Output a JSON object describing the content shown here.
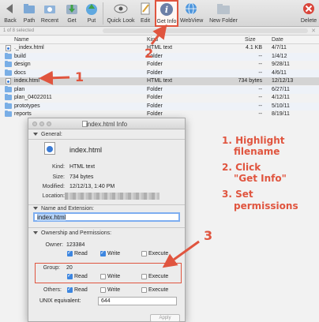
{
  "toolbar": {
    "buttons": [
      {
        "label": "Back"
      },
      {
        "label": "Path"
      },
      {
        "label": "Recent"
      },
      {
        "label": "Get"
      },
      {
        "label": "Put"
      },
      {
        "label": "Quick Look"
      },
      {
        "label": "Edit"
      },
      {
        "label": "Get Info"
      },
      {
        "label": "WebView"
      },
      {
        "label": "New Folder"
      },
      {
        "label": "Delete"
      }
    ]
  },
  "status": {
    "text": "1 of 8 selected"
  },
  "file_list": {
    "columns": {
      "name": "Name",
      "kind": "Kind",
      "size": "Size",
      "date": "Date"
    },
    "rows": [
      {
        "name": "._index.html",
        "kind": "HTML text",
        "size": "4.1 KB",
        "date": "4/7/11",
        "type": "doc"
      },
      {
        "name": "build",
        "kind": "Folder",
        "size": "--",
        "date": "1/4/12",
        "type": "folder"
      },
      {
        "name": "design",
        "kind": "Folder",
        "size": "--",
        "date": "9/28/11",
        "type": "folder"
      },
      {
        "name": "docs",
        "kind": "Folder",
        "size": "--",
        "date": "4/6/11",
        "type": "folder"
      },
      {
        "name": "index.html",
        "kind": "HTML text",
        "size": "734 bytes",
        "date": "12/12/13",
        "type": "doc"
      },
      {
        "name": "plan",
        "kind": "Folder",
        "size": "--",
        "date": "6/27/11",
        "type": "folder"
      },
      {
        "name": "plan_04022011",
        "kind": "Folder",
        "size": "--",
        "date": "4/12/11",
        "type": "folder"
      },
      {
        "name": "prototypes",
        "kind": "Folder",
        "size": "--",
        "date": "5/10/11",
        "type": "folder"
      },
      {
        "name": "reports",
        "kind": "Folder",
        "size": "--",
        "date": "8/19/11",
        "type": "folder"
      }
    ]
  },
  "info_window": {
    "title": "index.html Info",
    "general_label": "General:",
    "filename": "index.html",
    "kind_label": "Kind:",
    "kind": "HTML text",
    "size_label": "Size:",
    "size": "734 bytes",
    "modified_label": "Modified:",
    "modified": "12/12/13, 1:40 PM",
    "location_label": "Location:",
    "name_ext_label": "Name and Extension:",
    "name_value": "index.html",
    "ownership_label": "Ownership and Permissions:",
    "owner_label": "Owner:",
    "owner_value": "123384",
    "group_label": "Group:",
    "group_value": "20",
    "others_label": "Others:",
    "read_label": "Read",
    "write_label": "Write",
    "execute_label": "Execute",
    "unix_label": "UNIX equivalent:",
    "unix_value": "644",
    "apply_label": "Apply",
    "permissions": {
      "owner": {
        "read": true,
        "write": true,
        "execute": false
      },
      "group": {
        "read": true,
        "write": false,
        "execute": false
      },
      "others": {
        "read": true,
        "write": false,
        "execute": false
      }
    }
  },
  "annotations": {
    "num1": "1",
    "num2": "2",
    "num3": "3",
    "step1": "1. Highlight",
    "step1b": "filename",
    "step2": "2. Click",
    "step2b": "\"Get Info\"",
    "step3": "3. Set",
    "step3b": "permissions",
    "color": "#e0553f"
  }
}
